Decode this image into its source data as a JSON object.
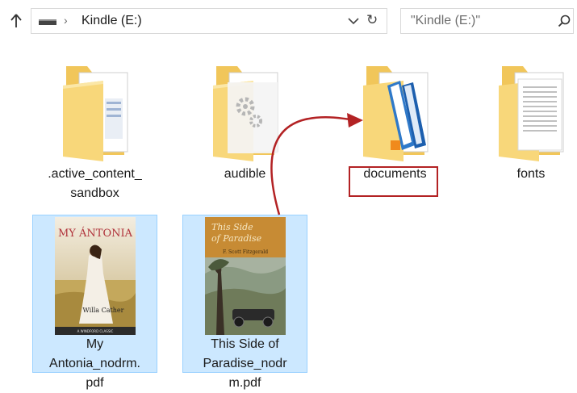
{
  "nav": {
    "up_icon": "arrow-up-icon",
    "drive_icon": "usb-drive-icon",
    "separator": "›",
    "drive_label": "Kindle (E:)",
    "dropdown_icon": "chevron-down-icon",
    "refresh_icon": "refresh-icon",
    "refresh_glyph": "↻"
  },
  "search": {
    "placeholder": "\"Kindle (E:)\"",
    "icon": "search-icon"
  },
  "folders": [
    {
      "label": ".active_content_\nsandbox",
      "icon": "folder-document-icon"
    },
    {
      "label": "audible",
      "icon": "folder-gear-icon"
    },
    {
      "label": "documents",
      "icon": "folder-books-icon"
    },
    {
      "label": "fonts",
      "icon": "folder-text-icon"
    }
  ],
  "files": [
    {
      "label": "My\nAntonia_nodrm.\npdf",
      "cover_title": "MY ÁNTONIA",
      "cover_author": "Willa Cather",
      "cover_footer": "A WINDFORD CLASSIC",
      "selected": true
    },
    {
      "label": "This Side of\nParadise_nodr\nm.pdf",
      "cover_title_line1": "This Side",
      "cover_title_line2": "of Paradise",
      "cover_author": "F. Scott Fitzgerald",
      "selected": true
    }
  ],
  "colors": {
    "folder": "#f7d77a",
    "selection_bg": "#cce8ff",
    "selection_border": "#99d1ff",
    "annotation": "#b32224"
  }
}
